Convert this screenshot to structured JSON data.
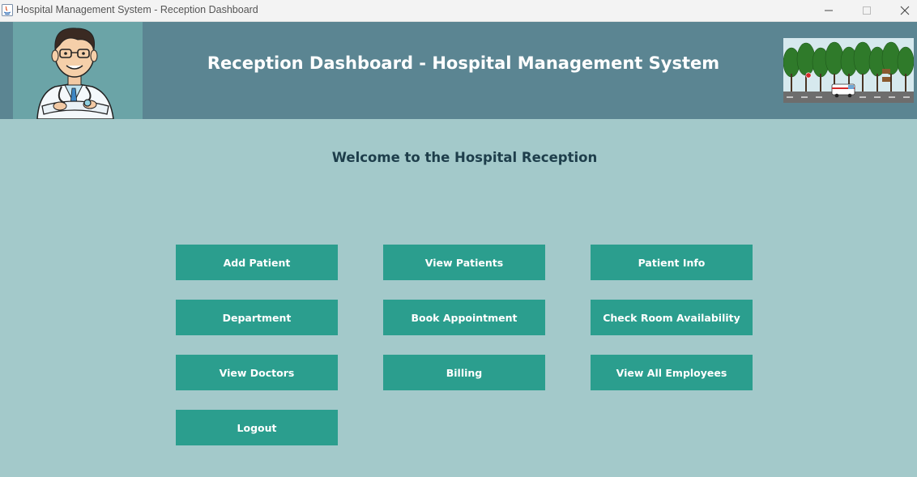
{
  "window": {
    "title": "Hospital Management System - Reception Dashboard",
    "controls": {
      "minimize": "minimize-icon",
      "maximize": "maximize-icon",
      "close": "close-icon"
    }
  },
  "header": {
    "title": "Reception Dashboard - Hospital Management System",
    "background_color": "#5b8592"
  },
  "main": {
    "welcome": "Welcome to the Hospital Reception",
    "background_color": "#a3c9ca",
    "button_color": "#2b9e8e",
    "buttons": [
      {
        "label": "Add Patient"
      },
      {
        "label": "View Patients"
      },
      {
        "label": "Patient Info"
      },
      {
        "label": "Department"
      },
      {
        "label": "Book Appointment"
      },
      {
        "label": "Check Room Availability"
      },
      {
        "label": "View Doctors"
      },
      {
        "label": "Billing"
      },
      {
        "label": "View All Employees"
      },
      {
        "label": "Logout"
      }
    ]
  }
}
